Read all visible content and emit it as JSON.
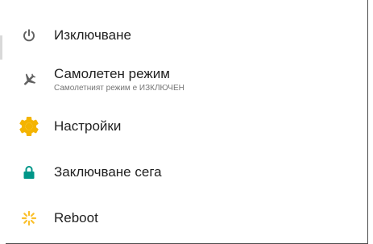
{
  "menu": {
    "items": [
      {
        "label": "Изключване",
        "icon": "power-icon"
      },
      {
        "label": "Самолетен режим",
        "subtitle": "Самолетният режим е ИЗКЛЮЧЕН",
        "icon": "airplane-icon"
      },
      {
        "label": "Настройки",
        "icon": "settings-gear-icon"
      },
      {
        "label": "Заключване сега",
        "icon": "lock-icon"
      },
      {
        "label": "Reboot",
        "icon": "reboot-icon"
      }
    ]
  },
  "colors": {
    "text": "#212121",
    "subtext": "#757575",
    "icon_gray": "#616161",
    "settings_yellow": "#F4B400",
    "lock_teal": "#009688",
    "reboot_yellow": "#FBC02D"
  }
}
